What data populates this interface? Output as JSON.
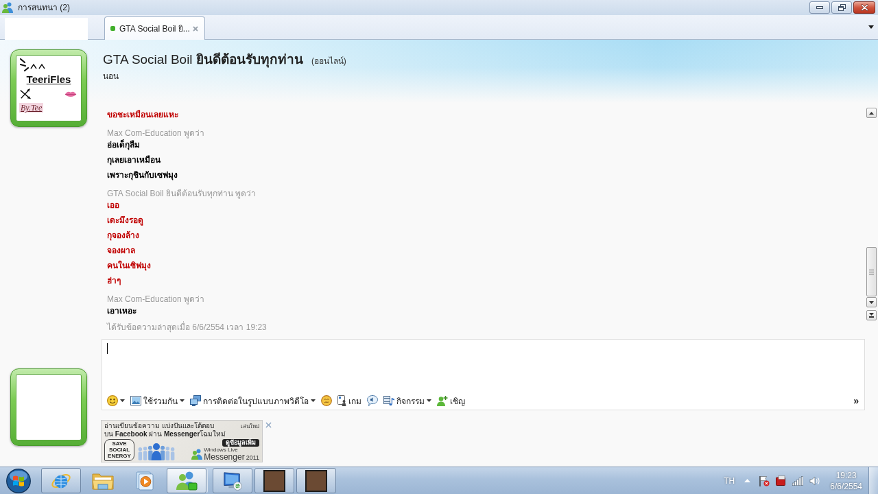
{
  "window": {
    "title": "การสนทนา (2)"
  },
  "tabs": [
    {
      "label": "GTA Social Boil ยิ...",
      "selected": true,
      "color": "#3fae2a"
    }
  ],
  "contact": {
    "display_picture": {
      "title": "TeeriFles",
      "signature": "By.Tee"
    },
    "name": "GTA Social Boil **ยินดีต้อนรับทุกท่าน**",
    "status": "(ออนไลน์)",
    "personal_message": "นอน"
  },
  "history": {
    "groups": [
      {
        "lines": [
          "ขอชะเหมือนเลยแหะ"
        ],
        "color": "#c00000"
      },
      {
        "sender": "Max Com-Education พูดว่า",
        "lines": [
          "อ่อเด็กุลืม",
          "กุเลยเอาเหมือน",
          "เพราะกุชินกับเซฟมุง"
        ],
        "color": "#000000"
      },
      {
        "sender": "GTA Social Boil ยินดีต้อนรับทุกท่าน พูดว่า",
        "lines": [
          "เออ",
          "เดะมึงรอดู",
          "กุจองล้าง",
          "จองผาล",
          "คนในเซิฟมุง",
          "ฮ่าๆ"
        ],
        "color": "#c00000"
      },
      {
        "sender": "Max Com-Education พูดว่า",
        "lines": [
          "เอาเหอะ"
        ],
        "color": "#000000"
      }
    ],
    "footer": "ได้รับข้อความล่าสุดเมื่อ 6/6/2554 เวลา 19:23"
  },
  "compose": {
    "toolbar": [
      {
        "kind": "emoticon",
        "dropdown": true
      },
      {
        "kind": "share",
        "label": "ใช้ร่วมกัน",
        "dropdown": true
      },
      {
        "kind": "video",
        "label": "การติดต่อในรูปแบบภาพวิดีโอ",
        "dropdown": true
      },
      {
        "kind": "nudge",
        "dropdown": false
      },
      {
        "kind": "games",
        "label": "เกม",
        "dropdown": false
      },
      {
        "kind": "voice",
        "dropdown": false
      },
      {
        "kind": "activities",
        "label": "กิจกรรม",
        "dropdown": true
      },
      {
        "kind": "invite",
        "label": "เชิญ",
        "dropdown": false
      }
    ],
    "overflow": "»"
  },
  "ad": {
    "headline": [
      "อ่านเขียนข้อความ แบ่งปันและโต้ตอบ",
      "บน **Facebook** ผ่าน **Messenger**โฉมใหม่"
    ],
    "replay": "เล่นใหม่",
    "more": "ดูข้อมูลเพิ่ม",
    "badge": "SAVE SOCIAL ENERGY",
    "brand_caption": "Windows Live",
    "brand": "Messenger",
    "year": "2011"
  },
  "taskbar": {
    "buttons": [
      {
        "kind": "browser",
        "running": true,
        "active": false
      },
      {
        "kind": "folder",
        "running": false,
        "active": false
      },
      {
        "kind": "media",
        "running": false,
        "active": false
      },
      {
        "kind": "messenger",
        "running": true,
        "active": true
      },
      {
        "kind": "remote",
        "running": true,
        "active": false
      },
      {
        "kind": "picture",
        "running": true,
        "active": false
      },
      {
        "kind": "picture",
        "running": true,
        "active": false
      }
    ],
    "language": "TH",
    "time": "19:23",
    "date": "6/6/2554"
  }
}
